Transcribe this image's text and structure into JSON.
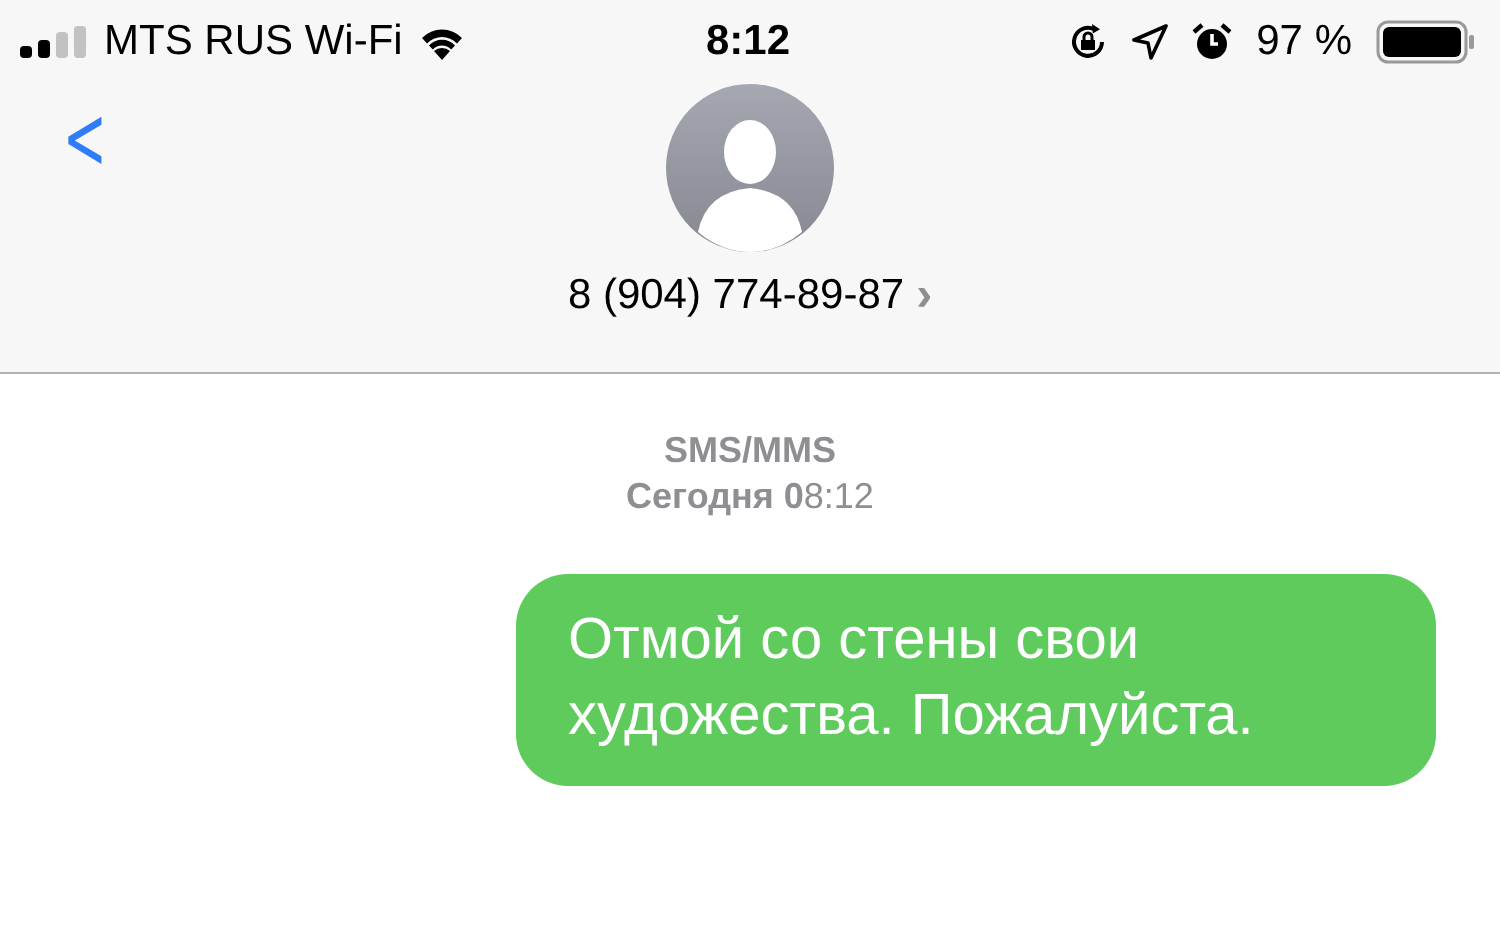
{
  "status_bar": {
    "carrier": "MTS RUS Wi-Fi",
    "time": "8:12",
    "battery": "97 %"
  },
  "header": {
    "back": "<",
    "contact": "8 (904) 774-89-87",
    "chevron": "›"
  },
  "conversation": {
    "service": "SMS/MMS",
    "timestamp": "**Сегодня 0**8:12",
    "messages": [
      {
        "text": "Отмой со стены свои художества. Пожалуйста.",
        "kind": "outgoing"
      }
    ]
  }
}
